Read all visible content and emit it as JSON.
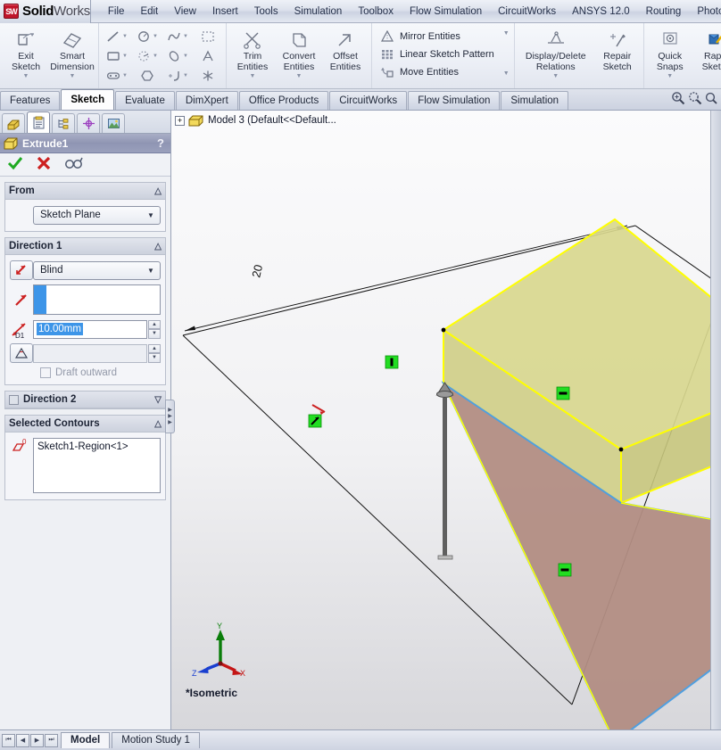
{
  "app": {
    "brand_bold": "Solid",
    "brand_light": "Works",
    "logo_text": "SW"
  },
  "menu": {
    "items": [
      {
        "label": "File"
      },
      {
        "label": "Edit"
      },
      {
        "label": "View"
      },
      {
        "label": "Insert"
      },
      {
        "label": "Tools"
      },
      {
        "label": "Simulation"
      },
      {
        "label": "Toolbox"
      },
      {
        "label": "Flow Simulation"
      },
      {
        "label": "CircuitWorks"
      },
      {
        "label": "ANSYS 12.0"
      },
      {
        "label": "Routing"
      },
      {
        "label": "PhotoWorks"
      }
    ]
  },
  "ribbon": {
    "exit_sketch": {
      "line1": "Exit",
      "line2": "Sketch",
      "icon": "exit-sketch-icon"
    },
    "smart_dimension": {
      "line1": "Smart",
      "line2": "Dimension",
      "icon": "smart-dimension-icon"
    },
    "sketch_tools": [
      {
        "name": "line-icon",
        "dropdown": true
      },
      {
        "name": "circle-icon",
        "dropdown": true
      },
      {
        "name": "spline-icon",
        "dropdown": true
      },
      {
        "name": "select-box-icon",
        "dropdown": false
      },
      {
        "name": "rectangle-icon",
        "dropdown": true
      },
      {
        "name": "arc-icon",
        "dropdown": true
      },
      {
        "name": "ellipse-icon",
        "dropdown": true
      },
      {
        "name": "sketch-text-icon",
        "dropdown": false
      },
      {
        "name": "slot-icon",
        "dropdown": true
      },
      {
        "name": "polygon-icon",
        "dropdown": false
      },
      {
        "name": "sketch-fillet-icon",
        "dropdown": true
      },
      {
        "name": "point-icon",
        "dropdown": false
      }
    ],
    "trim_entities": {
      "line1": "Trim",
      "line2": "Entities",
      "icon": "trim-entities-icon"
    },
    "convert_entities": {
      "line1": "Convert",
      "line2": "Entities",
      "icon": "convert-entities-icon"
    },
    "offset_entities": {
      "line1": "Offset",
      "line2": "Entities",
      "icon": "offset-entities-icon"
    },
    "small_commands": [
      {
        "label": "Mirror Entities",
        "icon": "mirror-entities-icon"
      },
      {
        "label": "Linear Sketch Pattern",
        "icon": "linear-sketch-pattern-icon"
      },
      {
        "label": "Move Entities",
        "icon": "move-entities-icon"
      }
    ],
    "display_delete_relations": {
      "line1": "Display/Delete",
      "line2": "Relations",
      "icon": "display-delete-relations-icon"
    },
    "repair_sketch": {
      "line1": "Repair",
      "line2": "Sketch",
      "icon": "repair-sketch-icon"
    },
    "quick_snaps": {
      "line1": "Quick",
      "line2": "Snaps",
      "icon": "quick-snaps-icon"
    },
    "rapid_sketch": {
      "line1": "Rapid",
      "line2": "Sketch",
      "icon": "rapid-sketch-icon"
    }
  },
  "command_tabs": {
    "items": [
      {
        "label": "Features",
        "active": false
      },
      {
        "label": "Sketch",
        "active": true
      },
      {
        "label": "Evaluate",
        "active": false
      },
      {
        "label": "DimXpert",
        "active": false
      },
      {
        "label": "Office Products",
        "active": false
      },
      {
        "label": "CircuitWorks",
        "active": false
      },
      {
        "label": "Flow Simulation",
        "active": false
      },
      {
        "label": "Simulation",
        "active": false
      }
    ],
    "tools": [
      {
        "name": "zoom-in-icon"
      },
      {
        "name": "zoom-area-icon"
      },
      {
        "name": "zoom-fit-icon"
      }
    ]
  },
  "property_manager": {
    "tabs": [
      {
        "name": "feature-manager-tree-tab",
        "active": false
      },
      {
        "name": "property-manager-tab",
        "active": true
      },
      {
        "name": "configuration-manager-tab",
        "active": false
      },
      {
        "name": "dimxpert-manager-tab",
        "active": false
      },
      {
        "name": "display-manager-tab",
        "active": false
      }
    ],
    "title": "Extrude1",
    "help_label": "?",
    "actions": [
      {
        "name": "ok-button",
        "glyph": "✔"
      },
      {
        "name": "cancel-button",
        "glyph": "✖"
      },
      {
        "name": "preview-button",
        "glyph": "∞"
      }
    ],
    "from": {
      "header": "From",
      "condition": "Sketch Plane"
    },
    "direction1": {
      "header": "Direction 1",
      "end_condition": "Blind",
      "direction_icon": "reverse-direction-icon",
      "face_selection": "",
      "depth_label": "D1",
      "depth_value": "10.00mm",
      "draft_value": "",
      "draft_checkbox_label": "Draft outward",
      "draft_checked": false
    },
    "direction2": {
      "header": "Direction 2",
      "enabled": false
    },
    "selected_contours": {
      "header": "Selected Contours",
      "items": [
        "Sketch1-Region<1>"
      ],
      "count_badge": "0"
    }
  },
  "graphics": {
    "tree_node": "Model 3  (Default<<Default...",
    "expand_glyph": "+",
    "view_orientation": "*Isometric",
    "dimension_label": "20",
    "triad": {
      "x_label": "X",
      "y_label": "Y",
      "z_label": "Z"
    },
    "colors": {
      "preview_face": "#d8d78e",
      "preview_edge": "#ffff00",
      "sketch_face": "#b28d83",
      "sketch_edge": "#4f9fe0",
      "relation_marker": "#22dd22",
      "background_top": "#fbfbfc",
      "background_bottom": "#d7d7db"
    },
    "relation_markers": [
      {
        "name": "vertical-relation-marker"
      },
      {
        "name": "horizontal-relation-marker"
      },
      {
        "name": "horizontal-relation-marker"
      },
      {
        "name": "coincident-relation-marker"
      }
    ],
    "drag_handle": "extrude-depth-drag-handle"
  },
  "status_bar": {
    "nav": [
      {
        "name": "first-tab-button",
        "glyph": "⏮"
      },
      {
        "name": "previous-tab-button",
        "glyph": "◀"
      },
      {
        "name": "next-tab-button",
        "glyph": "▶"
      },
      {
        "name": "last-tab-button",
        "glyph": "⏭"
      }
    ],
    "tabs": [
      {
        "label": "Model",
        "active": true
      },
      {
        "label": "Motion Study 1",
        "active": false
      }
    ]
  }
}
